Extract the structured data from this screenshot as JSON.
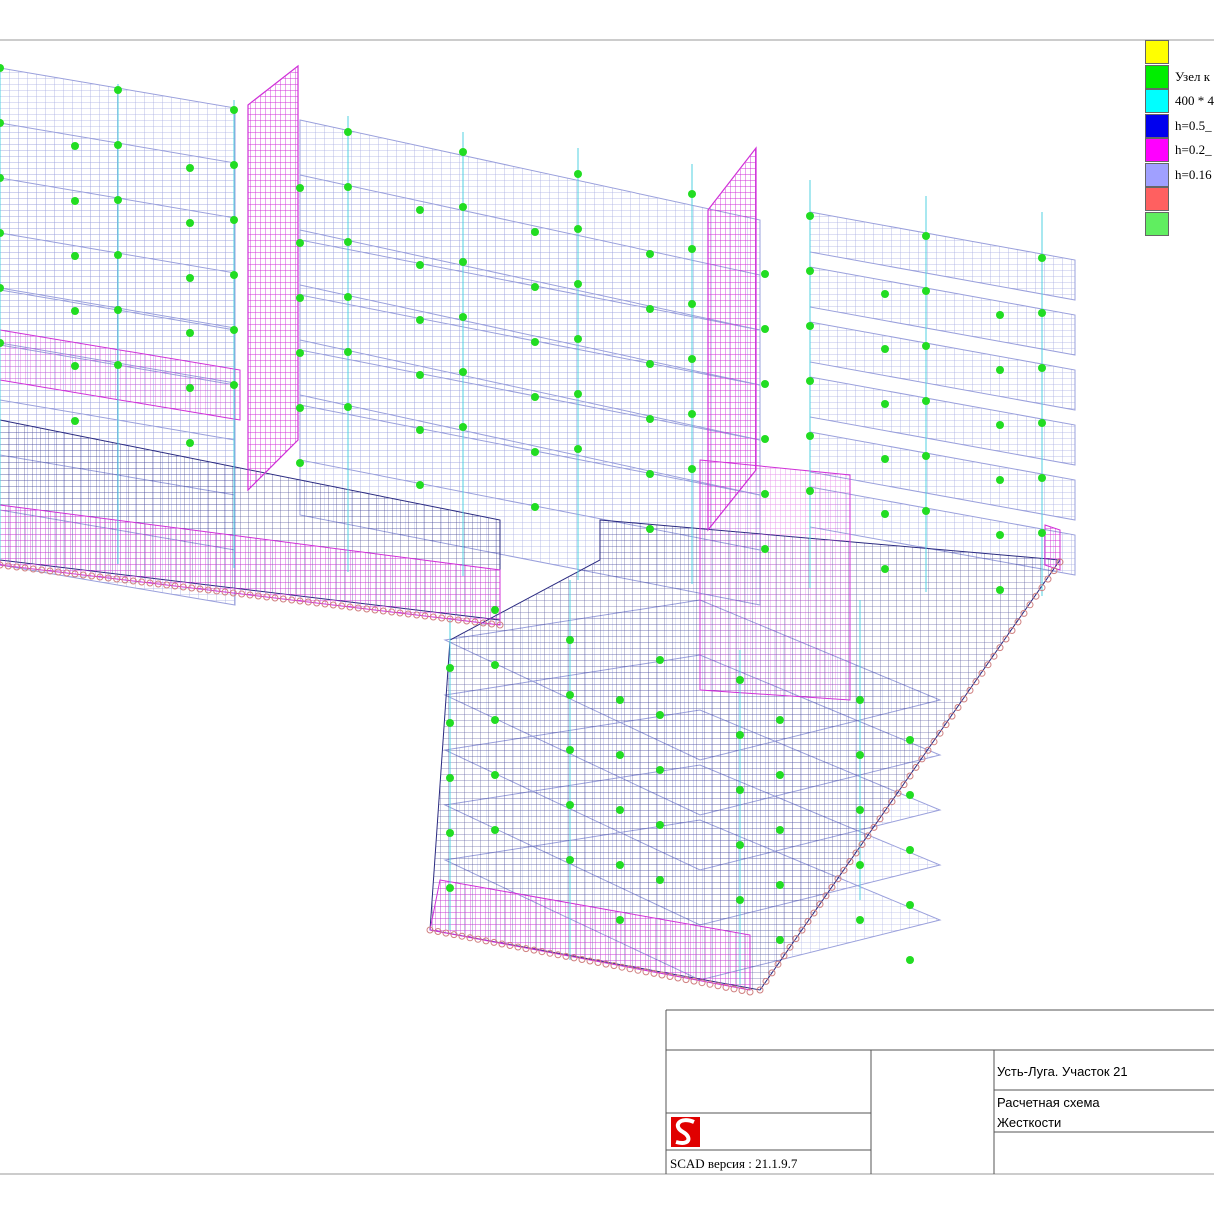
{
  "legend": {
    "items": [
      {
        "color": "#ffff00",
        "label": ""
      },
      {
        "color": "#00ee00",
        "label": "Узел к"
      },
      {
        "color": "#00ffff",
        "label": "400 * 4"
      },
      {
        "color": "#0000ee",
        "label": "h=0.5_"
      },
      {
        "color": "#ff00ff",
        "label": "h=0.2_"
      },
      {
        "color": "#a0a0ff",
        "label": "h=0.16"
      },
      {
        "color": "#ff6060",
        "label": ""
      },
      {
        "color": "#60ee60",
        "label": ""
      }
    ]
  },
  "title_block": {
    "project": "Усть-Луга. Участок 21",
    "drawing_line1": "Расчетная схема",
    "drawing_line2": "Жесткости",
    "version": "SCAD версия : 21.1.9.7"
  },
  "colors": {
    "upper_mesh": "#9aa0dc",
    "lower_mesh": "#2a2a80",
    "wall_mesh": "#d030d8",
    "column": "#50d0e0",
    "node": "#22dd22",
    "pile": "#d08080",
    "logo": "#e00000"
  }
}
